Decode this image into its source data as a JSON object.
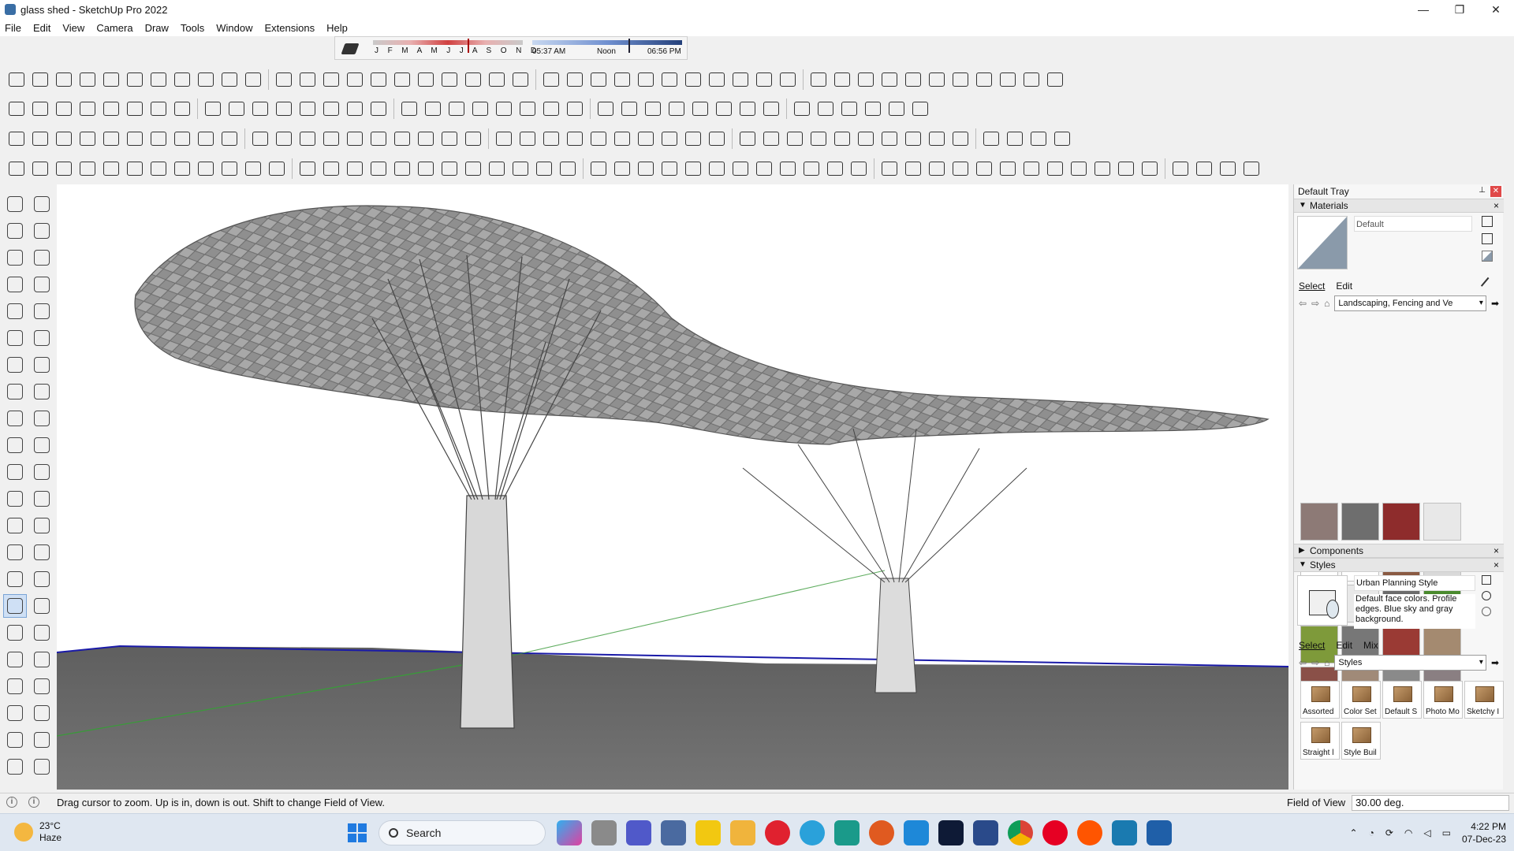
{
  "window": {
    "title": "glass shed - SketchUp Pro 2022",
    "controls": [
      "—",
      "❐",
      "✕"
    ]
  },
  "menu": [
    "File",
    "Edit",
    "View",
    "Camera",
    "Draw",
    "Tools",
    "Window",
    "Extensions",
    "Help"
  ],
  "shadow_settings": {
    "months_label": "J F M A M J J A S O N D",
    "time_start": "05:37 AM",
    "time_mid": "Noon",
    "time_end": "06:56 PM"
  },
  "tray": {
    "title": "Default Tray",
    "pin": "⊥",
    "close": "✕",
    "materials": {
      "header": "Materials",
      "current": "Default",
      "tabs": [
        "Select",
        "Edit"
      ],
      "collection": "Landscaping, Fencing and Ve",
      "swatch_colors": [
        "#8d7a76",
        "#6e6e6e",
        "#8e2c2c",
        "#e8e8e8",
        "#ffffff",
        "#ffffff",
        "#8a5a42",
        "#d9d9d9",
        "#7b7b7b",
        "#e8e8e8",
        "#6b6b6b",
        "#4a8a2e",
        "#7e9a3a",
        "#777777",
        "#9a3a34",
        "#a48a70",
        "#8a5048",
        "#a08a78",
        "#8a8a8a",
        "#8a7f82"
      ]
    },
    "components": {
      "header": "Components"
    },
    "styles": {
      "header": "Styles",
      "current_name": "Urban Planning Style",
      "description": "Default face colors. Profile edges. Blue sky and gray background.",
      "tabs": [
        "Select",
        "Edit",
        "Mix"
      ],
      "collection": "Styles",
      "items": [
        "Assorted",
        "Color Set",
        "Default S",
        "Photo Mo",
        "Sketchy I",
        "Straight l",
        "Style Buil"
      ]
    }
  },
  "status": {
    "hint": "Drag cursor to zoom.  Up is in, down is out. Shift to change Field of View.",
    "vcb_label": "Field of View",
    "vcb_value": "30.00 deg."
  },
  "taskbar": {
    "temperature": "23°C",
    "weather": "Haze",
    "search_label": "Search",
    "time": "4:22 PM",
    "date": "07-Dec-23"
  },
  "colors": {
    "accent": "#1f7ae0",
    "axis_blue": "#1a1aa8",
    "axis_green": "#3a9a3a",
    "ground": "#6e6e6e"
  }
}
